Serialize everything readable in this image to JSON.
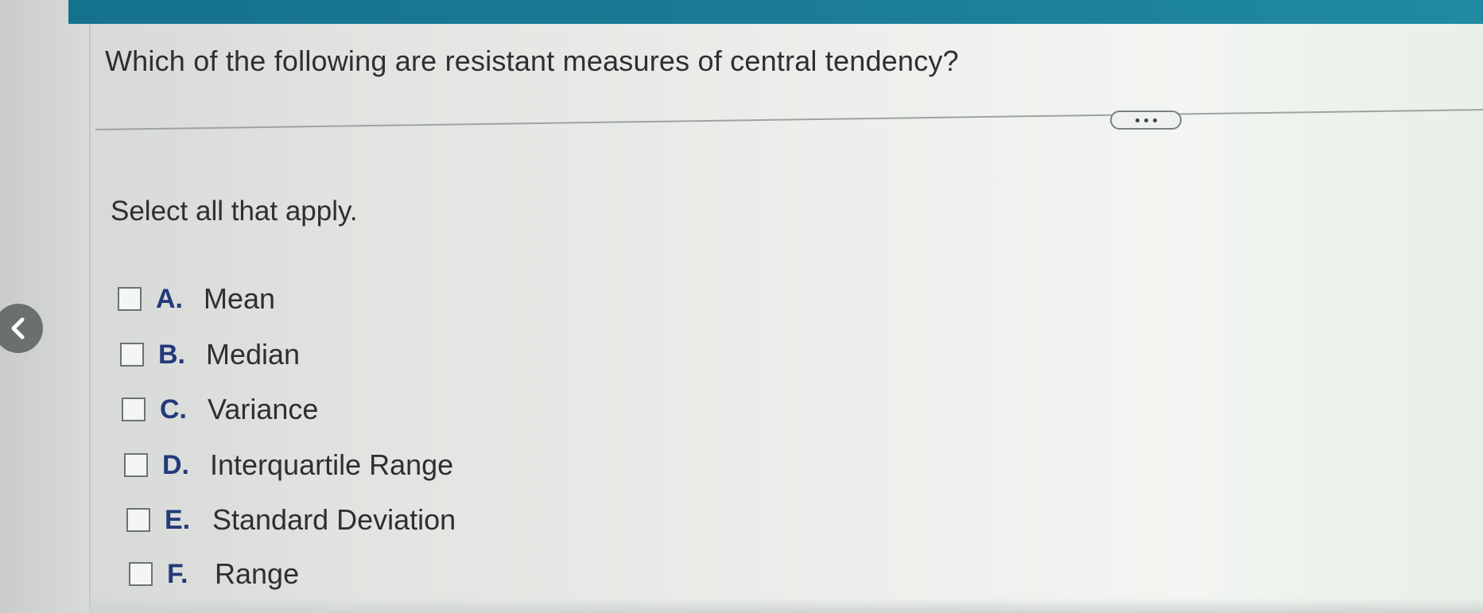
{
  "question": {
    "text": "Which of the following are resistant measures of central tendency?"
  },
  "instruction": {
    "text": "Select all that apply."
  },
  "more_button": {
    "icon": "ellipsis-icon"
  },
  "back_button": {
    "icon": "chevron-left-icon"
  },
  "options": [
    {
      "letter": "A.",
      "text": "Mean",
      "checked": false
    },
    {
      "letter": "B.",
      "text": "Median",
      "checked": false
    },
    {
      "letter": "C.",
      "text": "Variance",
      "checked": false
    },
    {
      "letter": "D.",
      "text": "Interquartile Range",
      "checked": false
    },
    {
      "letter": "E.",
      "text": "Standard Deviation",
      "checked": false
    },
    {
      "letter": "F.",
      "text": "Range",
      "checked": false
    }
  ],
  "colors": {
    "header_bar": "#1b7d97",
    "option_letter": "#233a7a",
    "text": "#2d2f30"
  }
}
